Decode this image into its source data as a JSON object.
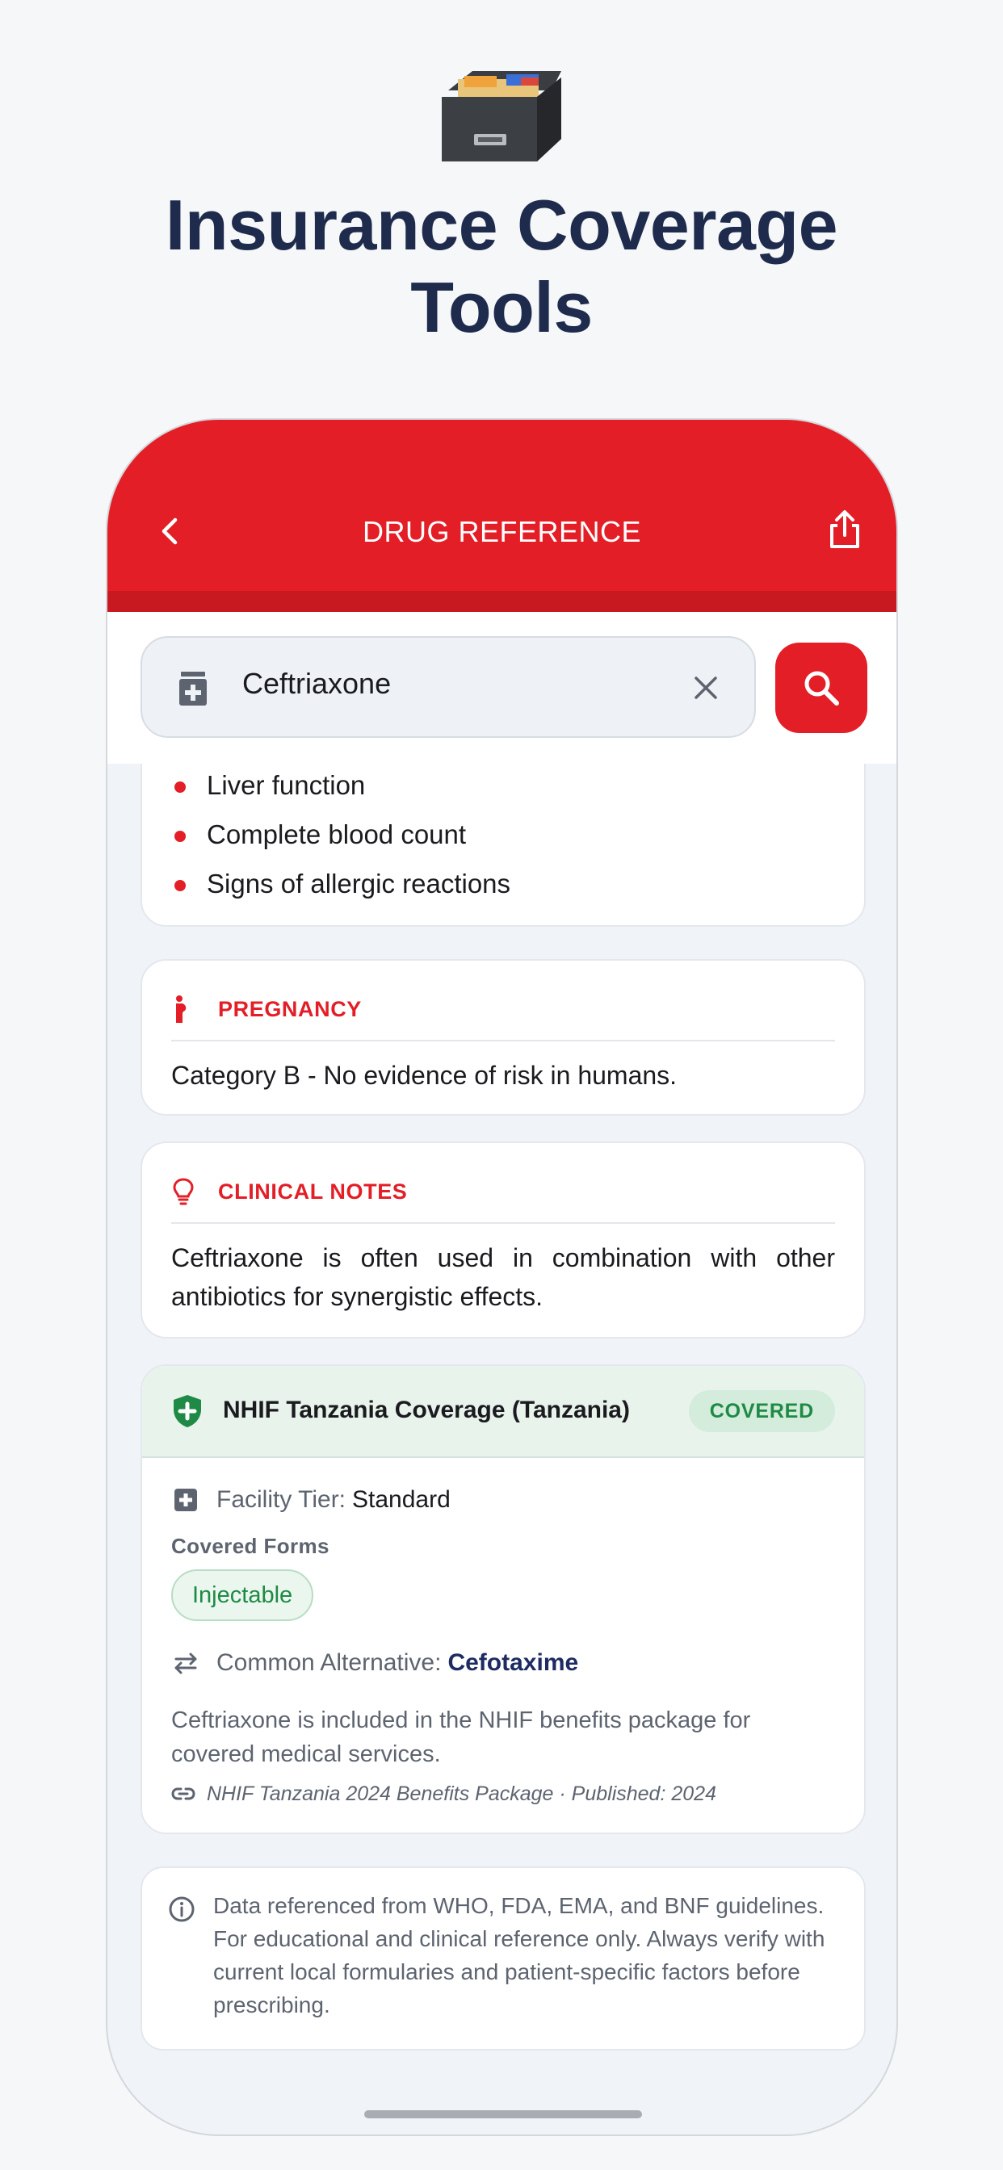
{
  "promo": {
    "icon": "card-file-box-icon",
    "title_line1": "Insurance Coverage",
    "title_line2": "Tools"
  },
  "appbar": {
    "title": "DRUG REFERENCE",
    "color": "#e31e26"
  },
  "search": {
    "value": "Ceftriaxone"
  },
  "monitoring": {
    "items": [
      "Liver function",
      "Complete blood count",
      "Signs of allergic reactions"
    ]
  },
  "pregnancy": {
    "label": "PREGNANCY",
    "text": "Category B - No evidence of risk in humans."
  },
  "clinical_notes": {
    "label": "CLINICAL NOTES",
    "text": "Ceftriaxone is often used in combination with other antibiotics for synergistic effects."
  },
  "coverage": {
    "title": "NHIF Tanzania Coverage (Tanzania)",
    "status": "COVERED",
    "status_color": "#1e8a45",
    "facility_tier_label": "Facility Tier:",
    "facility_tier_value": "Standard",
    "covered_forms_label": "Covered Forms",
    "forms": [
      "Injectable"
    ],
    "alternative_label": "Common Alternative:",
    "alternative_value": "Cefotaxime",
    "description": "Ceftriaxone is included in the NHIF benefits package for covered medical services.",
    "source": "NHIF Tanzania 2024 Benefits Package · Published: 2024"
  },
  "disclaimer": {
    "text": "Data referenced from WHO, FDA, EMA, and BNF guidelines. For educational and clinical reference only. Always verify with current local formularies and patient-specific factors before prescribing."
  }
}
